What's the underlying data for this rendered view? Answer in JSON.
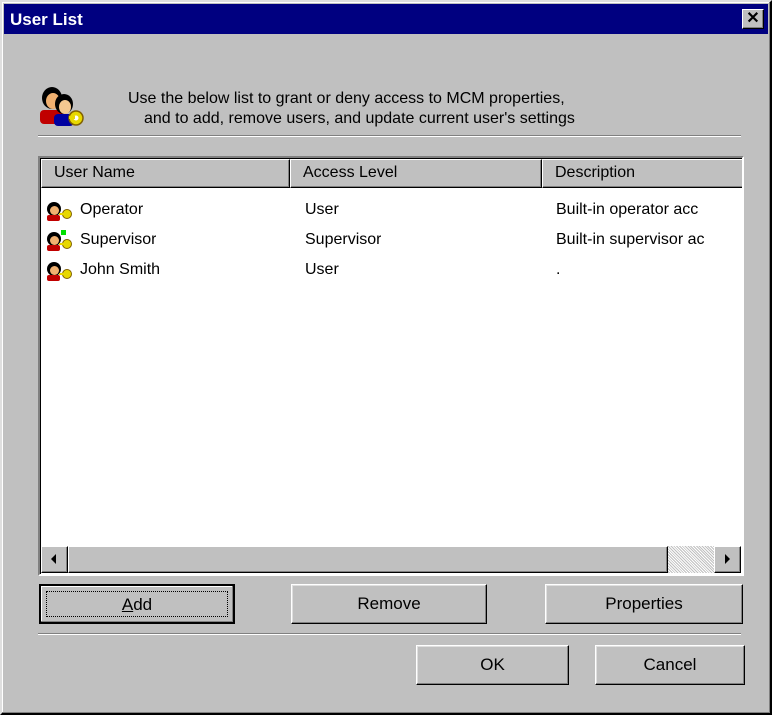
{
  "window": {
    "title": "User List",
    "close_label": "✕",
    "titlebar_color": "#000080"
  },
  "header": {
    "icon": "users-keys-icon",
    "line1": "Use the below list to grant or deny access to MCM properties,",
    "line2": "and to add, remove users, and update current user's settings"
  },
  "list": {
    "columns": [
      "User Name",
      "Access Level",
      "Description"
    ],
    "rows": [
      {
        "name": "Operator",
        "access": "User",
        "description": "Built-in operator acc",
        "icon": "user-key-icon"
      },
      {
        "name": "Supervisor",
        "access": "Supervisor",
        "description": "Built-in supervisor ac",
        "icon": "user-key-icon"
      },
      {
        "name": "John Smith",
        "access": "User",
        "description": ".",
        "icon": "user-key-icon"
      }
    ]
  },
  "buttons": {
    "add_mnemonic": "A",
    "add_rest": "dd",
    "remove": "Remove",
    "properties": "Properties",
    "ok": "OK",
    "cancel": "Cancel"
  }
}
